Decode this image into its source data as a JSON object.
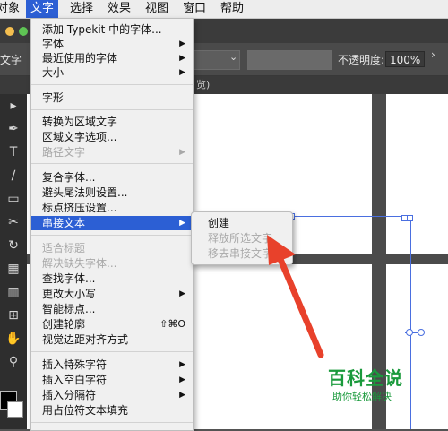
{
  "menubar": {
    "items": [
      {
        "label": "对象"
      },
      {
        "label": "文字"
      },
      {
        "label": "选择"
      },
      {
        "label": "效果"
      },
      {
        "label": "视图"
      },
      {
        "label": "窗口"
      },
      {
        "label": "帮助"
      }
    ]
  },
  "controlbar": {
    "left_label": "文字",
    "opacity_label": "不透明度:",
    "opacity_value": "100%",
    "tab_fragment": "览)"
  },
  "type_menu": {
    "items": [
      {
        "label": "添加 Typekit 中的字体...",
        "enabled": true
      },
      {
        "label": "字体",
        "enabled": true,
        "submenu": true
      },
      {
        "label": "最近使用的字体",
        "enabled": true,
        "submenu": true
      },
      {
        "label": "大小",
        "enabled": true,
        "submenu": true
      },
      {
        "label": "字形",
        "enabled": true
      },
      {
        "label": "转换为区域文字",
        "enabled": true
      },
      {
        "label": "区域文字选项...",
        "enabled": true
      },
      {
        "label": "路径文字",
        "enabled": false,
        "submenu": true
      },
      {
        "label": "复合字体...",
        "enabled": true
      },
      {
        "label": "避头尾法则设置...",
        "enabled": true
      },
      {
        "label": "标点挤压设置...",
        "enabled": true
      },
      {
        "label": "串接文本",
        "enabled": true,
        "submenu": true,
        "highlighted": true
      },
      {
        "label": "适合标题",
        "enabled": false
      },
      {
        "label": "解决缺失字体...",
        "enabled": false
      },
      {
        "label": "查找字体...",
        "enabled": true
      },
      {
        "label": "更改大小写",
        "enabled": true,
        "submenu": true
      },
      {
        "label": "智能标点...",
        "enabled": true
      },
      {
        "label": "创建轮廓",
        "enabled": true,
        "shortcut": "⇧⌘O"
      },
      {
        "label": "视觉边距对齐方式",
        "enabled": true
      },
      {
        "label": "插入特殊字符",
        "enabled": true,
        "submenu": true
      },
      {
        "label": "插入空白字符",
        "enabled": true,
        "submenu": true
      },
      {
        "label": "插入分隔符",
        "enabled": true,
        "submenu": true
      },
      {
        "label": "用占位符文本填充",
        "enabled": true
      }
    ]
  },
  "thread_submenu": {
    "items": [
      {
        "label": "创建",
        "enabled": true
      },
      {
        "label": "释放所选文字",
        "enabled": false
      },
      {
        "label": "移去串接文字",
        "enabled": false
      }
    ]
  },
  "watermark": {
    "title": "百科全说",
    "subtitle": "助你轻松解决"
  },
  "colors": {
    "menu_highlight": "#2c5fd4",
    "annotation_arrow": "#e8412b",
    "watermark_green": "#1a9a3c",
    "selection_blue": "#4a6fe0"
  },
  "icons": [
    "arrow-icon",
    "pen-icon",
    "type-icon",
    "brush-icon",
    "rect-icon",
    "scissors-icon",
    "rotate-icon",
    "zoom-icon",
    "hand-icon"
  ]
}
